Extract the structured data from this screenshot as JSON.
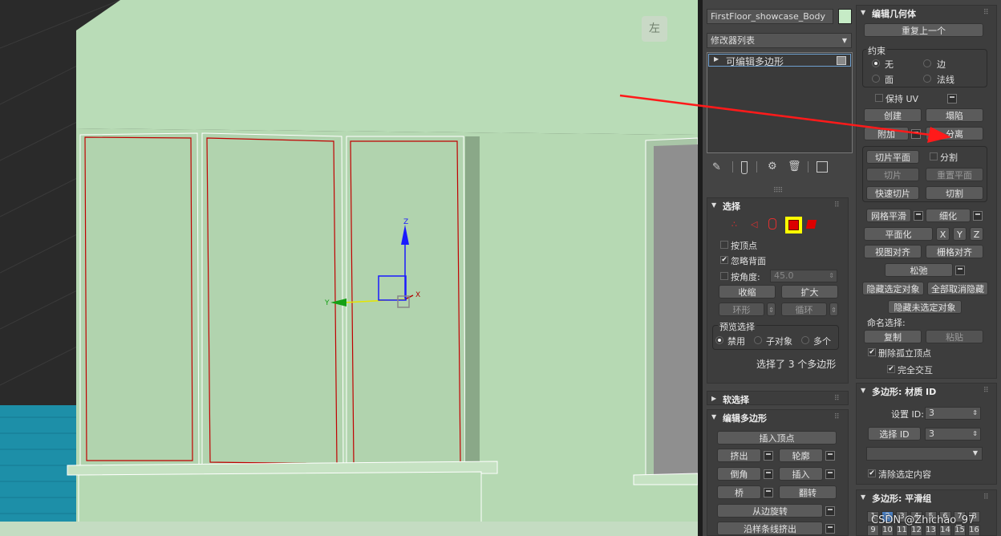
{
  "viewport": {
    "view_cube_label": "左"
  },
  "object": {
    "name": "FirstFloor_showcase_Body",
    "color": "#c6ebc6"
  },
  "modifier_list": {
    "label": "修改器列表"
  },
  "stack": {
    "item": "可编辑多边形"
  },
  "selection": {
    "title": "选择",
    "by_vertex": "按顶点",
    "ignore_backfacing": "忽略背面",
    "by_angle": "按角度:",
    "angle_value": "45.0",
    "shrink": "收缩",
    "grow": "扩大",
    "ring": "环形",
    "loop": "循环",
    "preview_label": "预览选择",
    "preview_off": "禁用",
    "preview_sub": "子对象",
    "preview_multi": "多个",
    "status": "选择了 3 个多边形"
  },
  "soft_selection": {
    "title": "软选择"
  },
  "edit_polygons": {
    "title": "编辑多边形",
    "insert_vertex": "插入顶点",
    "extrude": "挤出",
    "outline": "轮廓",
    "bevel": "倒角",
    "inset": "插入",
    "bridge": "桥",
    "flip": "翻转",
    "hinge": "从边旋转",
    "extrude_spline": "沿样条线挤出"
  },
  "edit_geometry": {
    "title": "编辑几何体",
    "repeat_last": "重复上一个",
    "constraints_label": "约束",
    "c_none": "无",
    "c_edge": "边",
    "c_face": "面",
    "c_normal": "法线",
    "preserve_uv": "保持 UV",
    "create": "创建",
    "collapse": "塌陷",
    "attach": "附加",
    "detach": "分离",
    "slice_plane": "切片平面",
    "split": "分割",
    "slice": "切片",
    "reset_plane": "重置平面",
    "quickslice": "快速切片",
    "cut": "切割",
    "meshsmooth": "网格平滑",
    "tessellate": "细化",
    "make_planar": "平面化",
    "x": "X",
    "y": "Y",
    "z": "Z",
    "view_align": "视图对齐",
    "grid_align": "栅格对齐",
    "relax": "松弛",
    "hide_selected": "隐藏选定对象",
    "unhide_all": "全部取消隐藏",
    "hide_unselected": "隐藏未选定对象",
    "named_sel_label": "命名选择:",
    "copy": "复制",
    "paste": "粘贴",
    "delete_isolated": "删除孤立顶点",
    "full_interactivity": "完全交互"
  },
  "material_ids": {
    "title": "多边形: 材质 ID",
    "set_id_label": "设置 ID:",
    "set_id_value": "3",
    "select_id": "选择 ID",
    "select_id_value": "3",
    "clear_selection": "清除选定内容"
  },
  "smoothing_groups": {
    "title": "多边形: 平滑组",
    "row1": [
      "1",
      "2",
      "3",
      "4",
      "5",
      "6",
      "7",
      "8"
    ],
    "row2": [
      "9",
      "10",
      "11",
      "12",
      "13",
      "14",
      "15",
      "16"
    ]
  },
  "watermark": "CSDN @Zhichao_97",
  "colors": {
    "annotation_arrow": "#ff1a1a",
    "highlight": "#ffff00",
    "selection_outline": "#c00000"
  }
}
